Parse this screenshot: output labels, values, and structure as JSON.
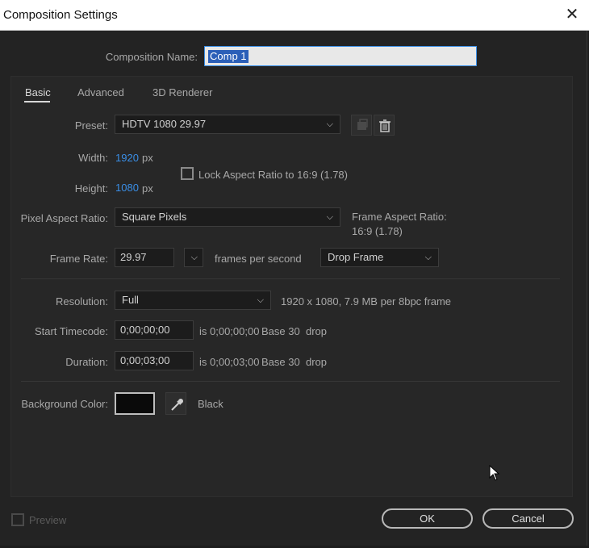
{
  "window": {
    "title": "Composition Settings",
    "close_glyph": "✕"
  },
  "comp_name": {
    "label": "Composition Name:",
    "value": "Comp 1"
  },
  "tabs": [
    {
      "label": "Basic",
      "active": true
    },
    {
      "label": "Advanced",
      "active": false
    },
    {
      "label": "3D Renderer",
      "active": false
    }
  ],
  "preset": {
    "label": "Preset:",
    "value": "HDTV 1080 29.97"
  },
  "width": {
    "label": "Width:",
    "value": "1920",
    "unit": "px"
  },
  "height": {
    "label": "Height:",
    "value": "1080",
    "unit": "px"
  },
  "lock_aspect": {
    "label": "Lock Aspect Ratio to 16:9 (1.78)",
    "checked": false
  },
  "pixel_aspect": {
    "label": "Pixel Aspect Ratio:",
    "value": "Square Pixels"
  },
  "frame_aspect": {
    "label": "Frame Aspect Ratio:",
    "value": "16:9 (1.78)"
  },
  "frame_rate": {
    "label": "Frame Rate:",
    "value": "29.97",
    "unit": "frames per second",
    "drop_value": "Drop Frame"
  },
  "resolution": {
    "label": "Resolution:",
    "value": "Full",
    "info": "1920 x 1080, 7.9 MB per 8bpc frame"
  },
  "start_timecode": {
    "label": "Start Timecode:",
    "value": "0;00;00;00",
    "is_text": "is 0;00;00;00",
    "base": "Base 30",
    "drop": "drop"
  },
  "duration": {
    "label": "Duration:",
    "value": "0;00;03;00",
    "is_text": "is 0;00;03;00",
    "base": "Base 30",
    "drop": "drop"
  },
  "background": {
    "label": "Background Color:",
    "color": "#0a0a0a",
    "name": "Black"
  },
  "preview": {
    "label": "Preview",
    "checked": false
  },
  "buttons": {
    "ok": "OK",
    "cancel": "Cancel"
  },
  "colors": {
    "accent": "#3a8ee6",
    "panel": "#272727",
    "dialog": "#232323"
  }
}
